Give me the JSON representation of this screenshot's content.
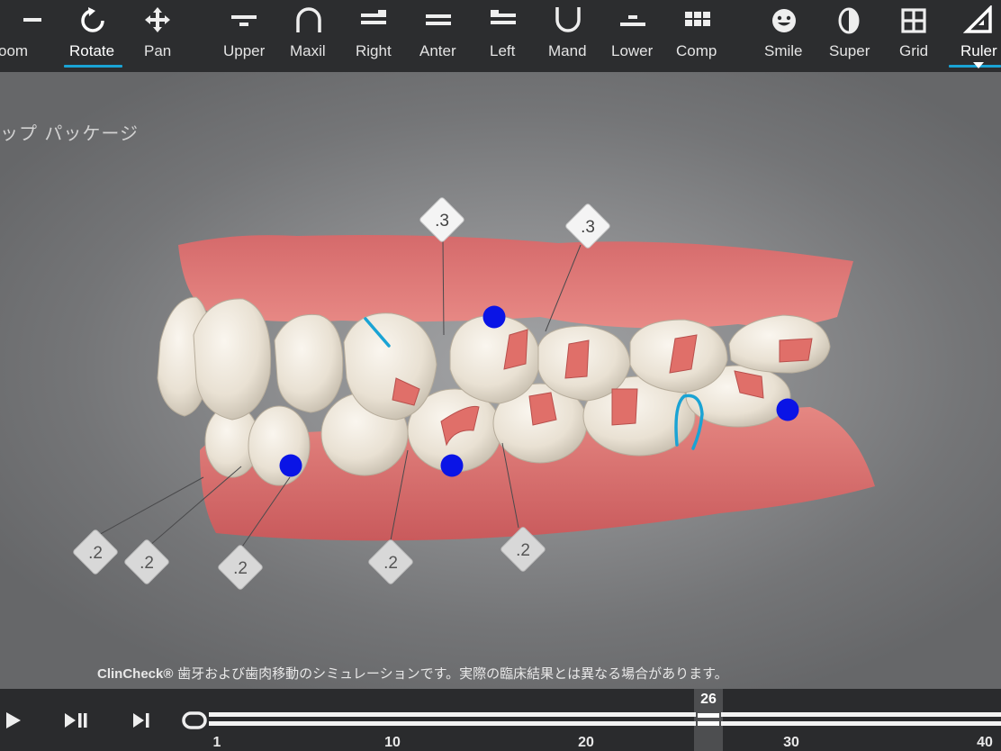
{
  "toolbar": {
    "items": [
      {
        "label": "oom",
        "icon": "zoom-out-icon"
      },
      {
        "label": "Rotate",
        "icon": "rotate-icon"
      },
      {
        "label": "Pan",
        "icon": "pan-icon"
      },
      {
        "label": "Upper",
        "icon": "upper-jaw-icon"
      },
      {
        "label": "Maxil",
        "icon": "maxillary-arch-icon"
      },
      {
        "label": "Right",
        "icon": "right-view-icon"
      },
      {
        "label": "Anter",
        "icon": "anterior-view-icon"
      },
      {
        "label": "Left",
        "icon": "left-view-icon"
      },
      {
        "label": "Mand",
        "icon": "mandibular-arch-icon"
      },
      {
        "label": "Lower",
        "icon": "lower-jaw-icon"
      },
      {
        "label": "Comp",
        "icon": "compare-icon"
      },
      {
        "label": "Smile",
        "icon": "smile-icon"
      },
      {
        "label": "Super",
        "icon": "superimpose-icon"
      },
      {
        "label": "Grid",
        "icon": "grid-icon"
      },
      {
        "label": "Ruler",
        "icon": "ruler-icon"
      }
    ],
    "active": [
      "Rotate",
      "Ruler"
    ],
    "accent_color": "#1aa3d4"
  },
  "viewport": {
    "package_label": "ップ パッケージ",
    "measurements": {
      "upper": [
        ".3",
        ".3"
      ],
      "lower": [
        ".2",
        ".2",
        ".2",
        ".2",
        ".2"
      ]
    },
    "marker_color": "#0a14e6",
    "disclaimer_brand": "ClinCheck®",
    "disclaimer_text": " 歯牙および歯肉移動のシミュレーションです。実際の臨床結果とは異なる場合があります。"
  },
  "timeline": {
    "current_stage": "26",
    "ticks": [
      "1",
      "10",
      "20",
      "30",
      "40"
    ]
  }
}
